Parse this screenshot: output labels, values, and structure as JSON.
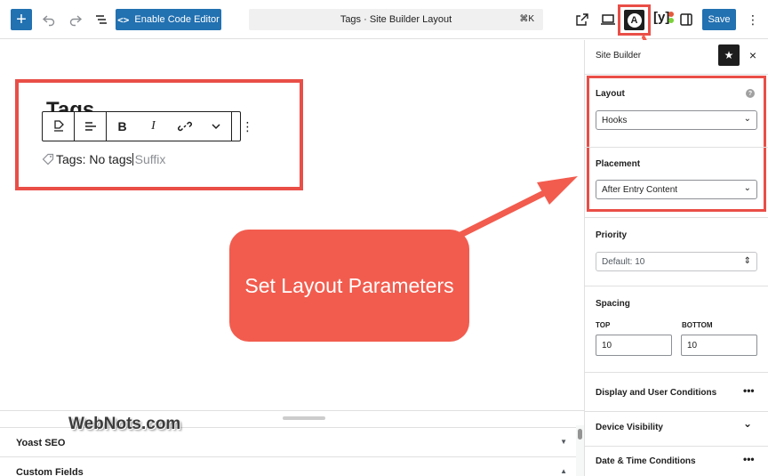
{
  "topbar": {
    "add_label": "+",
    "undo_icon": "undo-icon",
    "redo_icon": "redo-icon",
    "outline_icon": "list-view-icon",
    "code_editor_label": "Enable Code Editor",
    "command_title": "Tags · Site Builder Layout",
    "command_shortcut": "⌘K",
    "save_label": "Save",
    "more_label": "⋮",
    "accent_color": "#2271b1"
  },
  "canvas": {
    "post_title": "Tags",
    "tags_label": "Tags: No tags",
    "suffix_placeholder": "Suffix",
    "toolbar": {
      "bold": "B",
      "italic": "I",
      "more": "⋮"
    }
  },
  "callout": {
    "text": "Set Layout Parameters",
    "color": "#f25c4e"
  },
  "meta_boxes": {
    "items": [
      {
        "label": "Yoast SEO",
        "toggle": "▼"
      },
      {
        "label": "Custom Fields",
        "toggle": "▲"
      }
    ]
  },
  "watermark": "WebNots.com",
  "sidebar": {
    "title": "Site Builder",
    "close_label": "×",
    "layout": {
      "label": "Layout",
      "help": "?",
      "value": "Hooks"
    },
    "placement": {
      "label": "Placement",
      "value": "After Entry Content"
    },
    "priority": {
      "label": "Priority",
      "value": "Default: 10"
    },
    "spacing": {
      "label": "Spacing",
      "top_label": "TOP",
      "top_value": "10",
      "bottom_label": "BOTTOM",
      "bottom_value": "10"
    },
    "sections": [
      {
        "label": "Display and User Conditions",
        "control": "•••"
      },
      {
        "label": "Device Visibility",
        "control": "⌄"
      },
      {
        "label": "Date & Time Conditions",
        "control": "•••"
      }
    ]
  },
  "highlight_color": "#e94e47"
}
